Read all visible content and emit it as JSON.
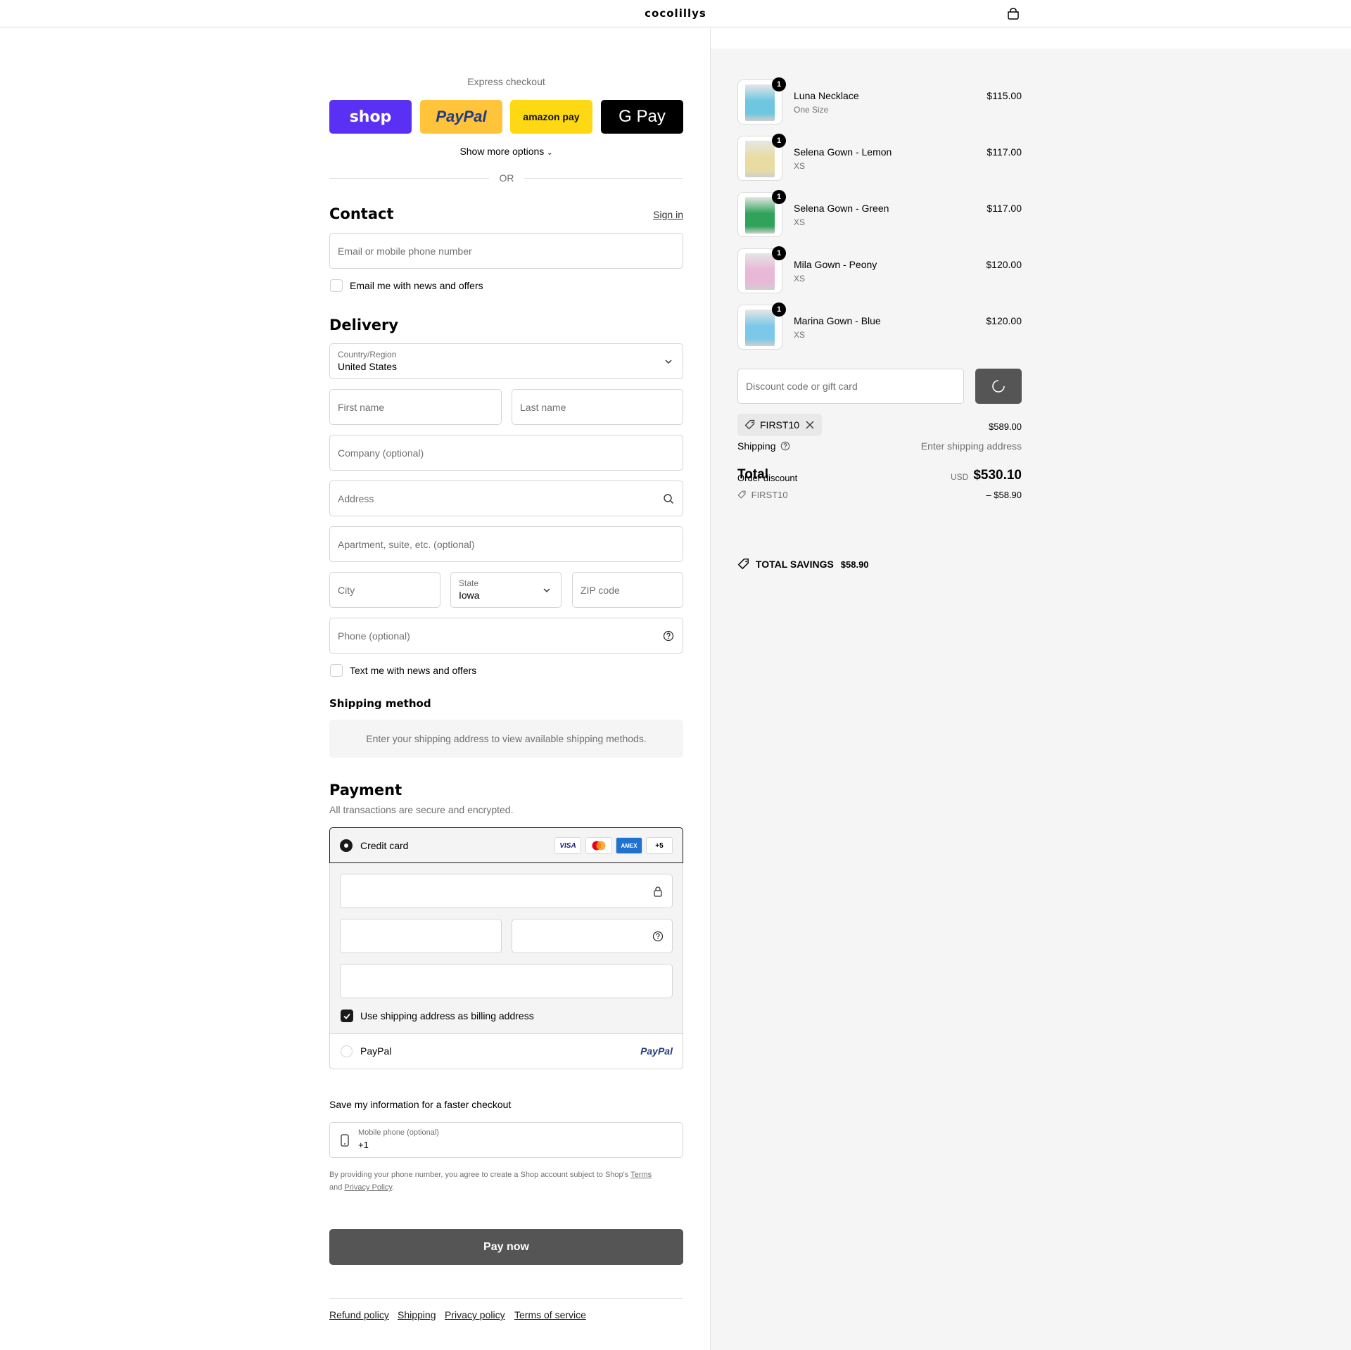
{
  "header": {
    "brand": "cocolillys"
  },
  "express": {
    "title": "Express checkout",
    "buttons": [
      "shop",
      "PayPal",
      "amazon pay",
      "G Pay"
    ],
    "show_more": "Show more options",
    "or": "OR"
  },
  "contact": {
    "title": "Contact",
    "sign_in": "Sign in",
    "email_placeholder": "Email or mobile phone number",
    "news_checkbox": "Email me with news and offers"
  },
  "delivery": {
    "title": "Delivery",
    "country_label": "Country/Region",
    "country_value": "United States",
    "first_name": "First name",
    "last_name": "Last name",
    "company": "Company (optional)",
    "address": "Address",
    "apartment": "Apartment, suite, etc. (optional)",
    "city": "City",
    "state_label": "State",
    "state_value": "Iowa",
    "zip": "ZIP code",
    "phone": "Phone (optional)",
    "text_checkbox": "Text me with news and offers"
  },
  "shipping_method": {
    "title": "Shipping method",
    "message": "Enter your shipping address to view available shipping methods."
  },
  "payment": {
    "title": "Payment",
    "subtitle": "All transactions are secure and encrypted.",
    "credit_card": "Credit card",
    "card_brands": [
      "VISA",
      "Mastercard",
      "AMEX",
      "+5"
    ],
    "billing_checkbox": "Use shipping address as billing address",
    "paypal": "PayPal",
    "paypal_logo": "PayPal"
  },
  "save_info": {
    "title": "Save my information for a faster checkout",
    "mobile_label": "Mobile phone (optional)",
    "mobile_value": "+1",
    "legal_prefix": "By providing your phone number, you agree to create a Shop account subject to Shop's",
    "terms": "Terms",
    "and": "and",
    "privacy": "Privacy Policy",
    "period": "."
  },
  "pay_now": "Pay now",
  "footer": [
    "Refund policy",
    "Shipping",
    "Privacy policy",
    "Terms of service"
  ],
  "order": {
    "items": [
      {
        "name": "Luna Necklace",
        "variant": "One Size",
        "price": "$115.00",
        "qty": "1",
        "color": "#6fc6e0"
      },
      {
        "name": "Selena Gown - Lemon",
        "variant": "XS",
        "price": "$117.00",
        "qty": "1",
        "color": "#e9dca3"
      },
      {
        "name": "Selena Gown - Green",
        "variant": "XS",
        "price": "$117.00",
        "qty": "1",
        "color": "#2fa35a"
      },
      {
        "name": "Mila Gown - Peony",
        "variant": "XS",
        "price": "$120.00",
        "qty": "1",
        "color": "#e8b8d8"
      },
      {
        "name": "Marina Gown - Blue",
        "variant": "XS",
        "price": "$120.00",
        "qty": "1",
        "color": "#7cc8e8"
      }
    ],
    "discount_placeholder": "Discount code or gift card",
    "applied_code": "FIRST10",
    "subtotal_value": "$589.00",
    "shipping_label": "Shipping",
    "shipping_value": "Enter shipping address",
    "total_label": "Total",
    "currency": "USD",
    "total_value": "$530.10",
    "order_discount_label": "Order discount",
    "discount_code": "FIRST10",
    "discount_value": "– $58.90",
    "savings_label": "TOTAL SAVINGS",
    "savings_value": "$58.90"
  },
  "colors": {
    "shop": "#5a31f4",
    "paypal": "#ffc439",
    "amazon": "#ffd814",
    "gpay": "#000000",
    "pay_now": "#555555",
    "apply": "#555555"
  }
}
